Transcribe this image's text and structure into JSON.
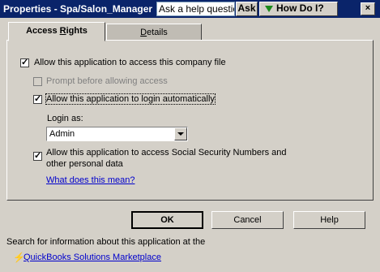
{
  "window": {
    "title": "Properties - Spa/Salon_Manager",
    "help_search_value": "Ask a help question",
    "ask_label": "Ask",
    "how_do_i_label": "How Do I?",
    "close_label": "×"
  },
  "tabs": {
    "access_rights_pre": "Access ",
    "access_rights_u": "R",
    "access_rights_post": "ights",
    "details_u": "D",
    "details_post": "etails"
  },
  "access": {
    "allow_access": {
      "label": "Allow this application to access this company file",
      "checked": true
    },
    "prompt_before": {
      "label": "Prompt before allowing access",
      "checked": false,
      "disabled": true
    },
    "login_auto": {
      "label": "Allow this application to login automatically",
      "checked": true
    },
    "login_as_label": "Login as:",
    "login_as_value": "Admin",
    "ssn_line1": "Allow this application to access Social Security Numbers and",
    "ssn_line2": "other personal data",
    "ssn_checked": true,
    "what_link": "What does this mean?"
  },
  "buttons": {
    "ok": "OK",
    "cancel": "Cancel",
    "help": "Help"
  },
  "footer": {
    "info_text": "Search for information about this application at the",
    "marketplace_link": "QuickBooks Solutions Marketplace"
  }
}
